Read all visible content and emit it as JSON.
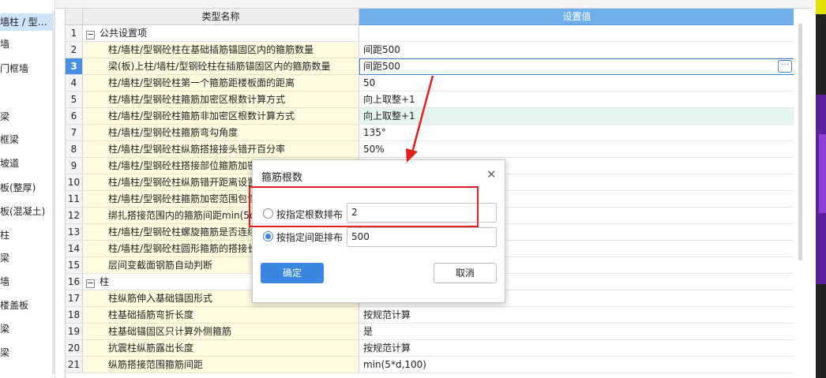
{
  "sidebar": {
    "items": [
      {
        "label": "墙柱 / 型…",
        "selected": true
      },
      {
        "label": "墙"
      },
      {
        "label": "门框墙"
      },
      {
        "label": "梁"
      },
      {
        "label": "框梁"
      },
      {
        "label": "坡道"
      },
      {
        "label": "板(整厚)"
      },
      {
        "label": "板(混凝土)"
      },
      {
        "label": "柱"
      },
      {
        "label": "梁"
      },
      {
        "label": "墙"
      },
      {
        "label": "楼盖板"
      },
      {
        "label": "梁"
      },
      {
        "label": "梁"
      }
    ]
  },
  "table": {
    "header_name": "类型名称",
    "header_value": "设置值",
    "rows": [
      {
        "num": "1",
        "name": "公共设置项",
        "value": "",
        "group": true,
        "expander": "−"
      },
      {
        "num": "2",
        "name": "柱/墙柱/型钢砼柱在基础插筋锚固区内的箍筋数量",
        "value": "间距500"
      },
      {
        "num": "3",
        "name": "梁(板)上柱/墙柱/型钢砼柱在插筋锚固区内的箍筋数量",
        "value": "间距500",
        "selected": true
      },
      {
        "num": "4",
        "name": "柱/墙柱/型钢砼柱第一个箍筋距楼板面的距离",
        "value": "50"
      },
      {
        "num": "5",
        "name": "柱/墙柱/型钢砼柱箍筋加密区根数计算方式",
        "value": "向上取整+1"
      },
      {
        "num": "6",
        "name": "柱/墙柱/型钢砼柱箍筋非加密区根数计算方式",
        "value": "向上取整+1",
        "highlight": true
      },
      {
        "num": "7",
        "name": "柱/墙柱/型钢砼柱箍筋弯勾角度",
        "value": "135°"
      },
      {
        "num": "8",
        "name": "柱/墙柱/型钢砼柱纵筋搭接接头错开百分率",
        "value": "50%"
      },
      {
        "num": "9",
        "name": "柱/墙柱/型钢砼柱搭接部位箍筋加密",
        "value": ""
      },
      {
        "num": "10",
        "name": "柱/墙柱/型钢砼柱纵筋错开距离设置",
        "value": ""
      },
      {
        "num": "11",
        "name": "柱/墙柱/型钢砼柱箍筋加密范围包含",
        "value": ""
      },
      {
        "num": "12",
        "name": "绑扎搭接范围内的箍筋间距min(5d",
        "value": ""
      },
      {
        "num": "13",
        "name": "柱/墙柱/型钢砼柱螺旋箍筋是否连续",
        "value": ""
      },
      {
        "num": "14",
        "name": "柱/墙柱/型钢砼柱圆形箍筋的搭接长",
        "value": ""
      },
      {
        "num": "15",
        "name": "层间变截面钢筋自动判断",
        "value": ""
      },
      {
        "num": "16",
        "name": "柱",
        "value": "",
        "group": true,
        "expander": "−"
      },
      {
        "num": "17",
        "name": "柱纵筋伸入基础锚固形式",
        "value": ""
      },
      {
        "num": "18",
        "name": "柱基础插筋弯折长度",
        "value": "按规范计算"
      },
      {
        "num": "19",
        "name": "柱基础锚固区只计算外侧箍筋",
        "value": "是"
      },
      {
        "num": "20",
        "name": "抗震柱纵筋露出长度",
        "value": "按规范计算"
      },
      {
        "num": "21",
        "name": "纵筋搭接范围箍筋间距",
        "value": "min(5*d,100)"
      }
    ]
  },
  "dialog": {
    "title": "箍筋根数",
    "option1_label": "按指定根数排布",
    "option1_value": "2",
    "option2_label": "按指定间距排布",
    "option2_value": "500",
    "selected_option": 2,
    "ok_label": "确定",
    "cancel_label": "取消"
  },
  "colors": {
    "header_value_bg": "#6fb0ec",
    "annotation_red": "#e0201c",
    "primary_button": "#3a86e0"
  }
}
